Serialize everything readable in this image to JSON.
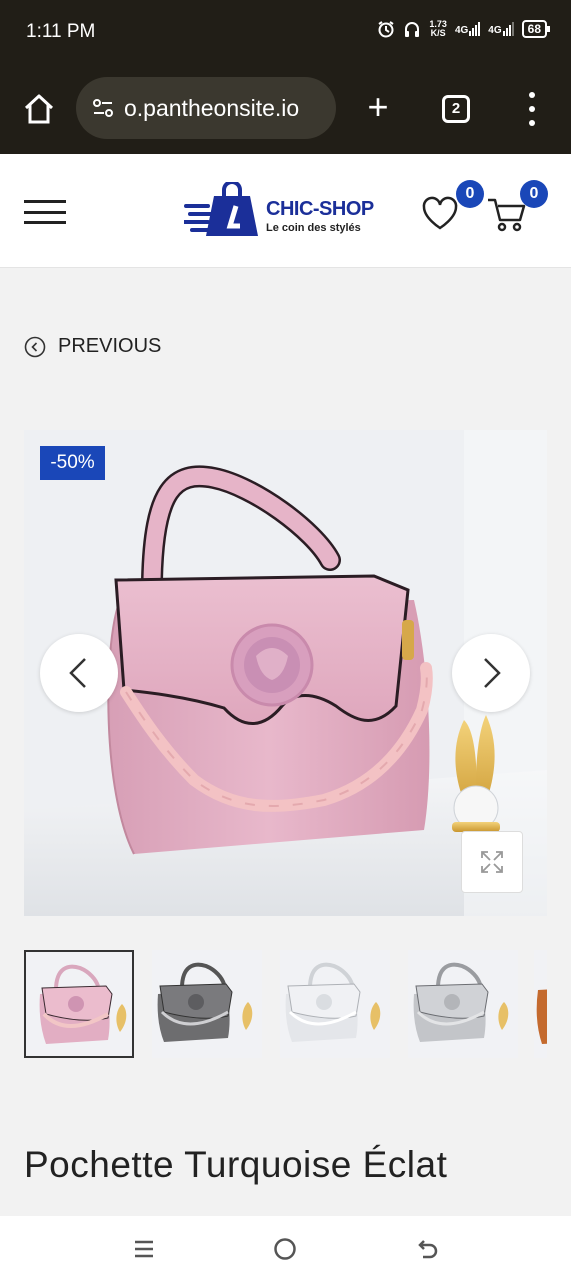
{
  "status_bar": {
    "time": "1:11 PM",
    "speed_value": "1.73",
    "speed_unit": "K/S",
    "net1": "4G",
    "net2": "4G",
    "battery": "68"
  },
  "browser": {
    "url": "o.pantheonsite.io",
    "tab_count": "2"
  },
  "header": {
    "logo_title": "CHIC-SHOP",
    "logo_subtitle": "Le coin des stylés",
    "wishlist_count": "0",
    "cart_count": "0"
  },
  "page": {
    "previous_label": "PREVIOUS",
    "discount_badge": "-50%",
    "product_title": "Pochette Turquoise Éclat"
  },
  "colors": {
    "brand_blue": "#1a47b8",
    "browser_dark": "#211e17"
  },
  "thumbnails": [
    {
      "color": "pink",
      "active": true
    },
    {
      "color": "grey",
      "active": false
    },
    {
      "color": "white",
      "active": false
    },
    {
      "color": "silver",
      "active": false
    },
    {
      "color": "brown",
      "active": false
    }
  ]
}
